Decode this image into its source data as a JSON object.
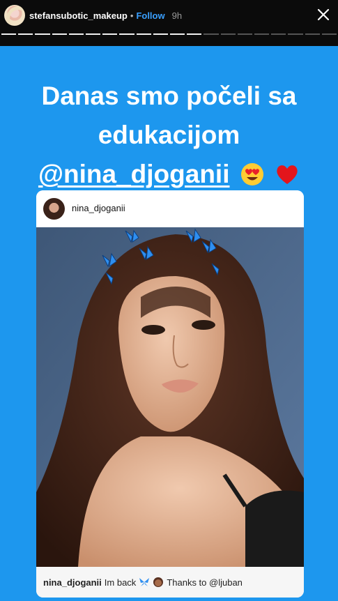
{
  "header": {
    "username": "stefansubotic_makeup",
    "separator": "•",
    "follow_label": "Follow",
    "time": "9h",
    "progress": {
      "total_segments": 20,
      "completed_segments": 12
    },
    "icons": {
      "close": "close-icon",
      "avatar": "profile-avatar"
    }
  },
  "story": {
    "background_color": "#1d97ee",
    "headline_line1": "Danas smo počeli sa",
    "headline_line2": "edukacijom",
    "headline_mention": "@nina_djoganii",
    "emojis": [
      "heart-eyes-emoji",
      "red-heart-emoji"
    ]
  },
  "shared_post": {
    "username": "nina_djoganii",
    "caption_user": "nina_djoganii",
    "caption_text1": "Im back",
    "caption_text2": "Thanks to @ljuban",
    "caption_icons": [
      "butterfly-emoji",
      "woman-emoji"
    ]
  }
}
